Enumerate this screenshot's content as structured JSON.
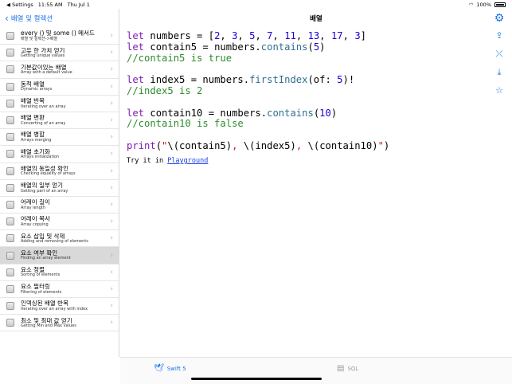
{
  "status": {
    "settings": "◀ Settings",
    "time": "11:55 AM",
    "date": "Thu Jul 1",
    "battery": "100%"
  },
  "sidebar": {
    "back_label": "배열 및 컬렉션",
    "items": [
      {
        "title": "every () 및 some () 메서드",
        "subtitle": "배열 및 컬렉션->배열",
        "active": false
      },
      {
        "title": "고유 한 가치 얻기",
        "subtitle": "Getting unique values",
        "active": false
      },
      {
        "title": "기본값이있는 배열",
        "subtitle": "Array with a default value",
        "active": false
      },
      {
        "title": "동적 배열",
        "subtitle": "Dynamic arrays",
        "active": false
      },
      {
        "title": "배열 반복",
        "subtitle": "Iterating over an array",
        "active": false
      },
      {
        "title": "배열 변환",
        "subtitle": "Converting of an array",
        "active": false
      },
      {
        "title": "배열 병합",
        "subtitle": "Arrays merging",
        "active": false
      },
      {
        "title": "배열 초기화",
        "subtitle": "Arrays initialization",
        "active": false
      },
      {
        "title": "배열의 동일성 확인",
        "subtitle": "Checking equality of arrays",
        "active": false
      },
      {
        "title": "배열의 일부 얻기",
        "subtitle": "Getting part of an array",
        "active": false
      },
      {
        "title": "어레이 길이",
        "subtitle": "Array length",
        "active": false
      },
      {
        "title": "어레이 복사",
        "subtitle": "Array copying",
        "active": false
      },
      {
        "title": "요소 삽입 및 삭제",
        "subtitle": "Adding and removing of elements",
        "active": false
      },
      {
        "title": "요소 여부 확인",
        "subtitle": "Finding an array element",
        "active": true
      },
      {
        "title": "요소 정렬",
        "subtitle": "Sorting of elements",
        "active": false
      },
      {
        "title": "요소 필터링",
        "subtitle": "Filtering of elements",
        "active": false
      },
      {
        "title": "인덱싱된 배열 반복",
        "subtitle": "Iterating over an array with index",
        "active": false
      },
      {
        "title": "최소 및 최대 값 얻기",
        "subtitle": "Getting Min and Max values",
        "active": false
      }
    ]
  },
  "main": {
    "title": "배열",
    "code_lines": [
      "let numbers = [2, 3, 5, 7, 11, 13, 17, 3]",
      "let contain5 = numbers.contains(5)",
      "//contain5 is true",
      "",
      "let index5 = numbers.firstIndex(of: 5)!",
      "//index5 is 2",
      "",
      "let contain10 = numbers.contains(10)",
      "//contain10 is false",
      "",
      "print(\"\\(contain5), \\(index5), \\(contain10)\")"
    ],
    "try_prefix": "Try it in ",
    "try_link": "Playground"
  },
  "tabs": {
    "swift": "Swift 5",
    "sql": "SQL"
  },
  "icons": {
    "gear": "gear-icon",
    "share": "share-icon",
    "collapse": "collapse-icon",
    "download": "download-icon",
    "star": "star-icon"
  },
  "colors": {
    "accent": "#1a73e8",
    "keyword": "#7d1cb1",
    "number": "#1a00d6",
    "comment": "#2e8b2e",
    "string": "#c41a16"
  }
}
